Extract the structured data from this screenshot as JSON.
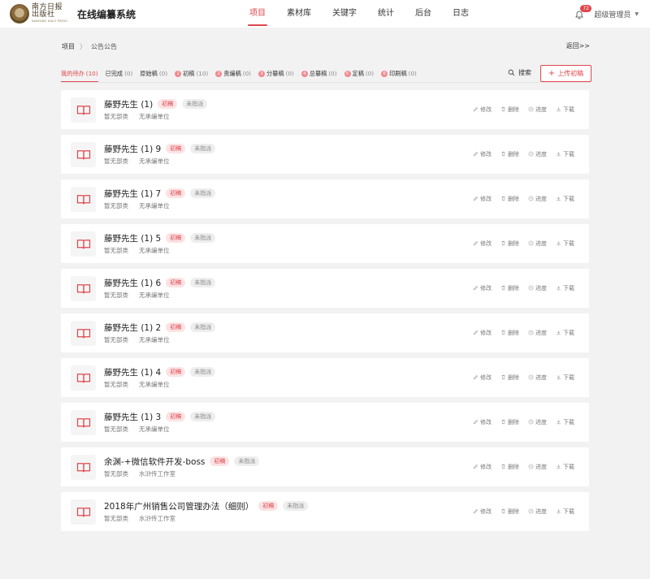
{
  "header": {
    "logo_cn": "南方日报出版社",
    "logo_en": "NANFANG DAILY PRESS",
    "app_title": "在线编纂系统",
    "nav": [
      {
        "label": "项目",
        "active": true
      },
      {
        "label": "素材库",
        "active": false
      },
      {
        "label": "关键字",
        "active": false
      },
      {
        "label": "统计",
        "active": false
      },
      {
        "label": "后台",
        "active": false
      },
      {
        "label": "日志",
        "active": false
      }
    ],
    "notification_count": "72",
    "user_name": "超级管理员",
    "user_caret": "▼"
  },
  "breadcrumb": {
    "root": "项目",
    "separator": "〉",
    "current": "公告公告",
    "back_label": "返回>>"
  },
  "tabs": [
    {
      "label": "我的待办",
      "count": "(10)",
      "num": "",
      "active": true
    },
    {
      "label": "已完成",
      "count": "(0)",
      "num": "",
      "active": false
    },
    {
      "label": "原始稿",
      "count": "(0)",
      "num": "",
      "active": false
    },
    {
      "label": "初稿",
      "count": "(10)",
      "num": "1",
      "active": false
    },
    {
      "label": "责编稿",
      "count": "(0)",
      "num": "2",
      "active": false
    },
    {
      "label": "分纂稿",
      "count": "(0)",
      "num": "3",
      "active": false
    },
    {
      "label": "总纂稿",
      "count": "(0)",
      "num": "4",
      "active": false
    },
    {
      "label": "定稿",
      "count": "(0)",
      "num": "5",
      "active": false
    },
    {
      "label": "印刷稿",
      "count": "(0)",
      "num": "6",
      "active": false
    }
  ],
  "toolbar": {
    "search_label": "搜索",
    "upload_label": "上传初稿"
  },
  "item_actions": {
    "edit": "修改",
    "delete": "删除",
    "progress": "进度",
    "download": "下载"
  },
  "items": [
    {
      "title": "藤野先生 (1)",
      "stage": "初稿",
      "status": "未指派",
      "category": "暂无部类",
      "unit": "无承编单位"
    },
    {
      "title": "藤野先生 (1) 9",
      "stage": "初稿",
      "status": "未指派",
      "category": "暂无部类",
      "unit": "无承编单位"
    },
    {
      "title": "藤野先生 (1) 7",
      "stage": "初稿",
      "status": "未指派",
      "category": "暂无部类",
      "unit": "无承编单位"
    },
    {
      "title": "藤野先生 (1) 5",
      "stage": "初稿",
      "status": "未指派",
      "category": "暂无部类",
      "unit": "无承编单位"
    },
    {
      "title": "藤野先生 (1) 6",
      "stage": "初稿",
      "status": "未指派",
      "category": "暂无部类",
      "unit": "无承编单位"
    },
    {
      "title": "藤野先生 (1) 2",
      "stage": "初稿",
      "status": "未指派",
      "category": "暂无部类",
      "unit": "无承编单位"
    },
    {
      "title": "藤野先生 (1) 4",
      "stage": "初稿",
      "status": "未指派",
      "category": "暂无部类",
      "unit": "无承编单位"
    },
    {
      "title": "藤野先生 (1) 3",
      "stage": "初稿",
      "status": "未指派",
      "category": "暂无部类",
      "unit": "无承编单位"
    },
    {
      "title": "余渊-+微信软件开发-boss",
      "stage": "初稿",
      "status": "未指派",
      "category": "暂无部类",
      "unit": "水浒传工作室"
    },
    {
      "title": "2018年广州销售公司管理办法（细则）",
      "stage": "初稿",
      "status": "未指派",
      "category": "暂无部类",
      "unit": "水浒传工作室"
    }
  ],
  "colors": {
    "accent": "#e0464d",
    "tag_draft_bg": "#fbe3e4",
    "tag_unassigned_bg": "#eeeeee",
    "page_bg": "#f2f2f2"
  },
  "icons": {
    "notification": "bell-icon",
    "search": "search-icon",
    "upload": "plus-icon",
    "item": "book-icon",
    "edit": "pencil-icon",
    "delete": "trash-icon",
    "progress": "clock-icon",
    "download": "download-icon"
  }
}
